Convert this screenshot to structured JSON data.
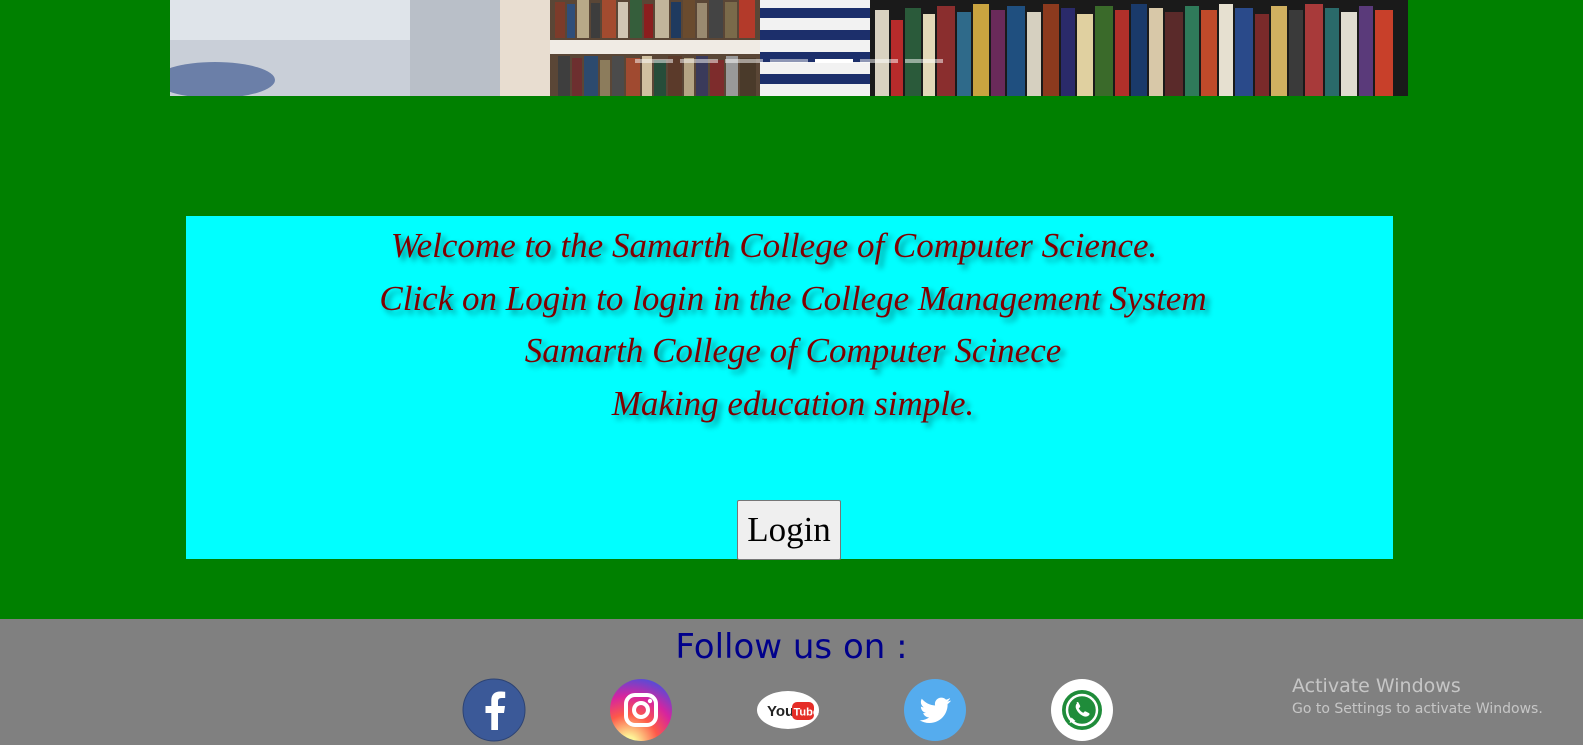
{
  "carousel": {
    "indicators": [
      {
        "active": false
      },
      {
        "active": false
      },
      {
        "active": false
      },
      {
        "active": false
      },
      {
        "active": true
      },
      {
        "active": false
      },
      {
        "active": false
      }
    ]
  },
  "welcome": {
    "lines": [
      "Welcome to the Samarth College of Computer Science.",
      "Click on Login to login in the College Management System",
      "Samarth College of Computer Scinece",
      "Making education simple."
    ],
    "login_label": "Login"
  },
  "footer": {
    "follow_title": "Follow us on :",
    "social_icons": [
      "facebook-icon",
      "instagram-icon",
      "youtube-icon",
      "twitter-icon",
      "whatsapp-icon"
    ]
  },
  "watermark": {
    "title": "Activate Windows",
    "subtitle": "Go to Settings to activate Windows."
  },
  "colors": {
    "page_background": "#008000",
    "welcome_background": "#00ffff",
    "welcome_text": "#800000",
    "footer_background": "#808080",
    "follow_text": "#00008b"
  }
}
